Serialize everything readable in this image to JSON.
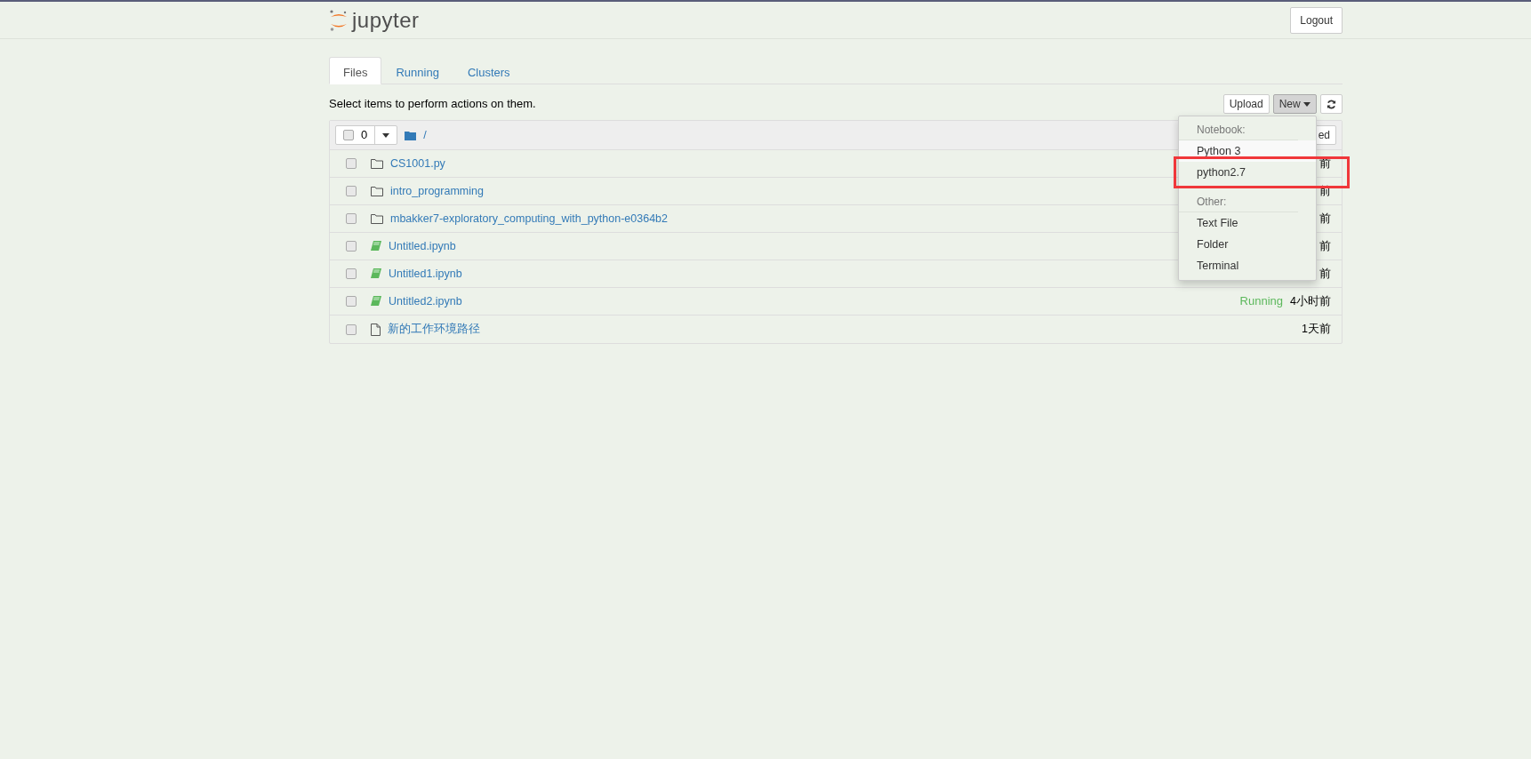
{
  "header": {
    "logo_text": "jupyter",
    "logout": "Logout"
  },
  "tabs": [
    {
      "label": "Files",
      "selected": true
    },
    {
      "label": "Running",
      "selected": false
    },
    {
      "label": "Clusters",
      "selected": false
    }
  ],
  "toolbar": {
    "hint": "Select items to perform actions on them.",
    "upload": "Upload",
    "new": "New",
    "new_open": true
  },
  "list_header": {
    "selected_count": "0",
    "path": "/",
    "sort_button": "ed"
  },
  "rows": [
    {
      "kind": "folder",
      "name": "CS1001.py",
      "time": "前",
      "checked": false
    },
    {
      "kind": "folder",
      "name": "intro_programming",
      "time": "前",
      "checked": false
    },
    {
      "kind": "folder",
      "name": "mbakker7-exploratory_computing_with_python-e0364b2",
      "time": "前",
      "checked": false
    },
    {
      "kind": "notebook",
      "name": "Untitled.ipynb",
      "time": "前",
      "checked": false
    },
    {
      "kind": "notebook",
      "name": "Untitled1.ipynb",
      "time": "前",
      "checked": false
    },
    {
      "kind": "notebook",
      "name": "Untitled2.ipynb",
      "status": "Running",
      "time": "4小时前",
      "checked": false
    },
    {
      "kind": "file",
      "name": "新的工作环境路径",
      "time": "1天前",
      "checked": false
    }
  ],
  "new_menu": [
    {
      "kind": "header",
      "label": "Notebook:"
    },
    {
      "kind": "item",
      "label": "Python 3",
      "highlighted": true,
      "outlined": false
    },
    {
      "kind": "item",
      "label": "python2.7",
      "highlighted": false,
      "outlined": true
    },
    {
      "kind": "divider"
    },
    {
      "kind": "header",
      "label": "Other:"
    },
    {
      "kind": "item",
      "label": "Text File",
      "highlighted": false,
      "outlined": false
    },
    {
      "kind": "item",
      "label": "Folder",
      "highlighted": false,
      "outlined": false
    },
    {
      "kind": "item",
      "label": "Terminal",
      "highlighted": false,
      "outlined": false
    }
  ]
}
